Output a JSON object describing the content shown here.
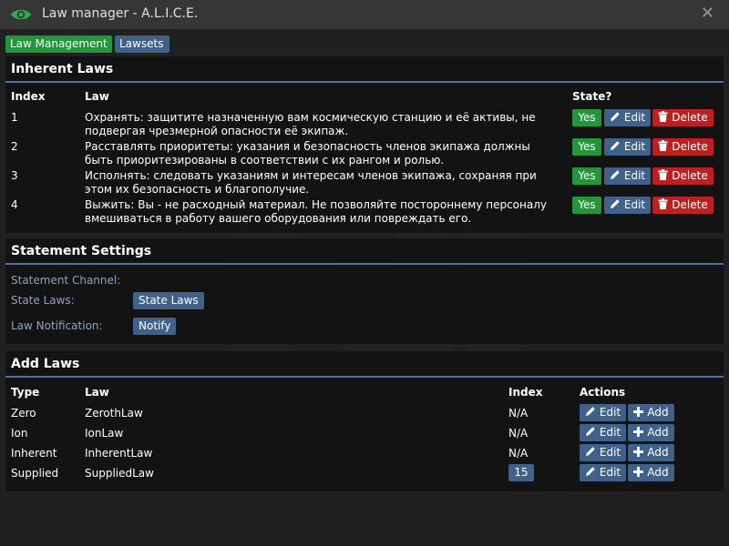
{
  "window": {
    "title": "Law manager - A.L.I.C.E.",
    "close": "✕"
  },
  "tabs": [
    {
      "label": "Law Management",
      "active": true
    },
    {
      "label": "Lawsets",
      "active": false
    }
  ],
  "inherent": {
    "title": "Inherent Laws",
    "headers": {
      "index": "Index",
      "law": "Law",
      "state": "State?"
    },
    "laws": [
      {
        "index": "1",
        "text": "Охранять: защитите назначенную вам космическую станцию и её активы, не подвергая чрезмерной опасности её экипаж."
      },
      {
        "index": "2",
        "text": "Расставлять приоритеты: указания и безопасность членов экипажа должны быть приоритезированы в соответствии с их рангом и ролью."
      },
      {
        "index": "3",
        "text": "Исполнять: следовать указаниям и интересам членов экипажа, сохраняя при этом их безопасность и благополучие."
      },
      {
        "index": "4",
        "text": "Выжить: Вы - не расходный материал. Не позволяйте постороннему персоналу вмешиваться в работу вашего оборудования или повреждать его."
      }
    ],
    "yes_label": "Yes",
    "edit_label": "Edit",
    "delete_label": "Delete"
  },
  "statement": {
    "title": "Statement Settings",
    "channel_label": "Statement Channel:",
    "state_laws_label": "State Laws:",
    "state_laws_button": "State Laws",
    "notification_label": "Law Notification:",
    "notify_button": "Notify"
  },
  "add": {
    "title": "Add Laws",
    "headers": {
      "type": "Type",
      "law": "Law",
      "index": "Index",
      "actions": "Actions"
    },
    "rows": [
      {
        "type": "Zero",
        "law": "ZerothLaw",
        "index": "N/A"
      },
      {
        "type": "Ion",
        "law": "IonLaw",
        "index": "N/A"
      },
      {
        "type": "Inherent",
        "law": "InherentLaw",
        "index": "N/A"
      },
      {
        "type": "Supplied",
        "law": "SuppliedLaw",
        "index": "15"
      }
    ],
    "edit_label": "Edit",
    "add_label": "Add"
  },
  "colors": {
    "green": "#21963a",
    "blue": "#40628a",
    "red": "#bd2020",
    "background": "#202020",
    "divider": "#4972a1"
  },
  "icons": {
    "app": "eye-icon",
    "edit": "pencil-icon",
    "delete": "trash-icon",
    "add": "plus-icon",
    "close": "close-icon"
  }
}
